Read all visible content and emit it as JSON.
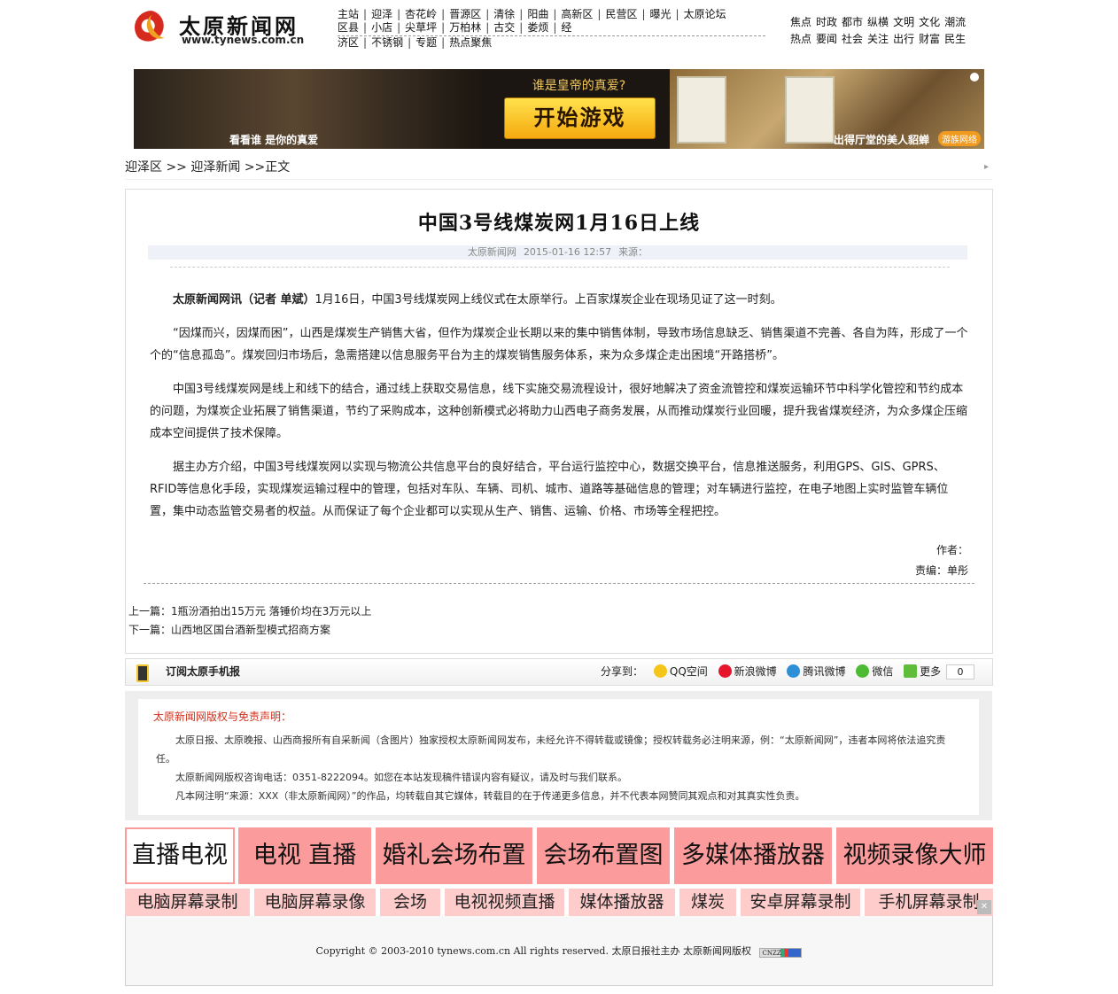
{
  "header": {
    "logo_name": "太原新闻网",
    "logo_url": "www.tynews.com.cn",
    "topnav_rows": [
      [
        "主站",
        "迎泽",
        "杏花岭",
        "晋源区",
        "清徐",
        "阳曲",
        "高新区",
        "民营区",
        "曝光",
        "太原论坛"
      ],
      [
        "区县",
        "小店",
        "尖草坪",
        "万柏林",
        "古交",
        "娄烦",
        "经"
      ],
      [
        "济区",
        "不锈钢",
        "专题",
        "热点聚焦"
      ]
    ],
    "sidenav_rows": [
      [
        "焦点",
        "时政",
        "都市",
        "纵横",
        "文明",
        "文化",
        "潮流"
      ],
      [
        "热点",
        "要闻",
        "社会",
        "关注",
        "出行",
        "财富",
        "民生"
      ]
    ]
  },
  "banner": {
    "left_caption": "看看谁 是你的真爱",
    "question": "谁是皇帝的真爱?",
    "button": "开始游戏",
    "right_caption": "出得厅堂的美人貂蝉",
    "brand": "游族网络"
  },
  "breadcrumb": {
    "section": "迎泽区",
    "sep": " >> ",
    "channel": "迎泽新闻",
    "sep2": " >>",
    "page": "正文"
  },
  "article": {
    "title": "中国3号线煤炭网1月16日上线",
    "meta": {
      "source": "太原新闻网",
      "datetime": "2015-01-16 12:57",
      "from_label": "来源："
    },
    "lead": "太原新闻网讯（记者 单斌）",
    "paragraphs": [
      "1月16日，中国3号线煤炭网上线仪式在太原举行。上百家煤炭企业在现场见证了这一时刻。",
      "“因煤而兴，因煤而困”，山西是煤炭生产销售大省，但作为煤炭企业长期以来的集中销售体制，导致市场信息缺乏、销售渠道不完善、各自为阵，形成了一个个的“信息孤岛”。煤炭回归市场后，急需搭建以信息服务平台为主的煤炭销售服务体系，来为众多煤企走出困境“开路搭桥”。",
      "中国3号线煤炭网是线上和线下的结合，通过线上获取交易信息，线下实施交易流程设计，很好地解决了资金流管控和煤炭运输环节中科学化管控和节约成本的问题，为煤炭企业拓展了销售渠道，节约了采购成本，这种创新模式必将助力山西电子商务发展，从而推动煤炭行业回暖，提升我省煤炭经济，为众多煤企压缩成本空间提供了技术保障。",
      "据主办方介绍，中国3号线煤炭网以实现与物流公共信息平台的良好结合，平台运行监控中心，数据交换平台，信息推送服务，利用GPS、GIS、GPRS、RFID等信息化手段，实现煤炭运输过程中的管理，包括对车队、车辆、司机、城市、道路等基础信息的管理；对车辆进行监控，在电子地图上实时监管车辆位置，集中动态监管交易者的权益。从而保证了每个企业都可以实现从生产、销售、运输、价格、市场等全程把控。"
    ],
    "author_label": "作者：",
    "editor_label": "责编：",
    "editor": "单彤",
    "prev_label": "上一篇：",
    "prev_title": "1瓶汾酒拍出15万元 落锤价均在3万元以上",
    "next_label": "下一篇：",
    "next_title": "山西地区国台酒新型模式招商方案"
  },
  "share": {
    "subscribe": "订阅太原手机报",
    "label": "分享到：",
    "targets": [
      "QQ空间",
      "新浪微博",
      "腾讯微博",
      "微信",
      "更多"
    ],
    "count": "0"
  },
  "disclaimer": {
    "heading": "太原新闻网版权与免责声明：",
    "lines": [
      "太原日报、太原晚报、山西商报所有自采新闻（含图片）独家授权太原新闻网发布，未经允许不得转载或镜像；授权转载务必注明来源，例：“太原新闻网”，违者本网将依法追究责任。",
      "太原新闻网版权咨询电话：0351-8222094。如您在本站发现稿件错误内容有疑议，请及时与我们联系。",
      "凡本网注明“来源：XXX（非太原新闻网）”的作品，均转载自其它媒体，转载目的在于传递更多信息，并不代表本网赞同其观点和对其真实性负责。"
    ]
  },
  "ads": {
    "big": [
      "直播电视",
      "电视 直播",
      "婚礼会场布置",
      "会场布置图",
      "多媒体播放器",
      "视频录像大师"
    ],
    "small": [
      "电脑屏幕录制",
      "电脑屏幕录像",
      "会场",
      "电视视频直播",
      "媒体播放器",
      "煤炭",
      "安卓屏幕录制",
      "手机屏幕录制"
    ]
  },
  "footer": {
    "copyright": "Copyright © 2003-2010 tynews.com.cn All rights reserved.",
    "host": "太原日报社主办",
    "owner": "太原新闻网版权",
    "badge": "CNZZ"
  }
}
